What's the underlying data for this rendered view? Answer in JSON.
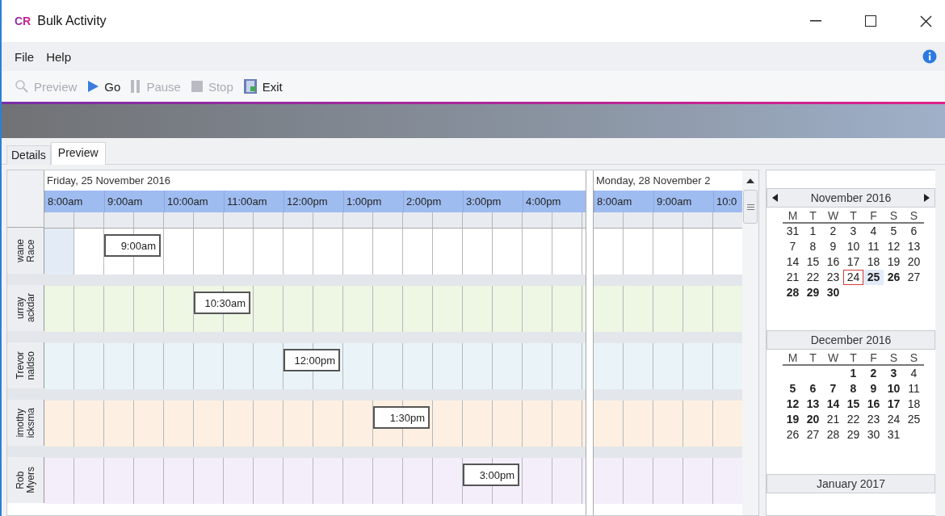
{
  "window": {
    "logo": "CR",
    "title": "Bulk Activity"
  },
  "menu": [
    {
      "label": "File"
    },
    {
      "label": "Help"
    }
  ],
  "toolbar": [
    {
      "label": "Preview",
      "kind": "search",
      "disabled": true
    },
    {
      "label": "Go",
      "kind": "play",
      "disabled": false
    },
    {
      "label": "Pause",
      "kind": "pause",
      "disabled": true
    },
    {
      "label": "Stop",
      "kind": "stop",
      "disabled": true
    },
    {
      "label": "Exit",
      "kind": "exit",
      "disabled": false
    }
  ],
  "tabs": [
    {
      "label": "Details",
      "selected": false
    },
    {
      "label": "Preview",
      "selected": true
    }
  ],
  "schedule": {
    "days": [
      {
        "title": "Friday, 25 November 2016",
        "hours": [
          "8:00am",
          "9:00am",
          "10:00am",
          "11:00am",
          "12:00pm",
          "1:00pm",
          "2:00pm",
          "3:00pm",
          "4:00pm"
        ]
      },
      {
        "title": "Monday, 28 November 2",
        "hours": [
          "8:00am",
          "9:00am",
          "10:0"
        ]
      }
    ],
    "resources": [
      {
        "name": [
          "wane",
          "Race"
        ],
        "color": "#ffffff",
        "cells": [
          {
            "kind": "highlight"
          },
          {
            "kind": "free"
          },
          {
            "kind": "booked",
            "time": "9:00am"
          },
          {
            "kind": "free"
          },
          {
            "kind": "free"
          },
          {
            "kind": "free"
          },
          {
            "kind": "free"
          },
          {
            "kind": "free"
          },
          {
            "kind": "free"
          },
          {
            "kind": "free"
          },
          {
            "kind": "free"
          },
          {
            "kind": "free"
          },
          {
            "kind": "free"
          },
          {
            "kind": "free"
          },
          {
            "kind": "free"
          },
          {
            "kind": "free"
          },
          {
            "kind": "free"
          },
          {
            "kind": "free"
          }
        ]
      },
      {
        "name": [
          "urray",
          "ackdar"
        ],
        "color": "#eef6e4",
        "cells": [
          {
            "kind": "free"
          },
          {
            "kind": "free"
          },
          {
            "kind": "free"
          },
          {
            "kind": "free"
          },
          {
            "kind": "free"
          },
          {
            "kind": "booked",
            "time": "10:30am"
          },
          {
            "kind": "free"
          },
          {
            "kind": "free"
          },
          {
            "kind": "free"
          },
          {
            "kind": "free"
          },
          {
            "kind": "free"
          },
          {
            "kind": "free"
          },
          {
            "kind": "free"
          },
          {
            "kind": "free"
          },
          {
            "kind": "free"
          },
          {
            "kind": "free"
          },
          {
            "kind": "free"
          },
          {
            "kind": "free"
          }
        ]
      },
      {
        "name": [
          "Trevor",
          "naldso"
        ],
        "color": "#eaf4f8",
        "cells": [
          {
            "kind": "free"
          },
          {
            "kind": "free"
          },
          {
            "kind": "free"
          },
          {
            "kind": "free"
          },
          {
            "kind": "free"
          },
          {
            "kind": "free"
          },
          {
            "kind": "free"
          },
          {
            "kind": "free"
          },
          {
            "kind": "booked",
            "time": "12:00pm"
          },
          {
            "kind": "free"
          },
          {
            "kind": "free"
          },
          {
            "kind": "free"
          },
          {
            "kind": "free"
          },
          {
            "kind": "free"
          },
          {
            "kind": "free"
          },
          {
            "kind": "free"
          },
          {
            "kind": "free"
          },
          {
            "kind": "free"
          }
        ]
      },
      {
        "name": [
          "imothy",
          "icksma"
        ],
        "color": "#fdf0e2",
        "cells": [
          {
            "kind": "free"
          },
          {
            "kind": "free"
          },
          {
            "kind": "free"
          },
          {
            "kind": "free"
          },
          {
            "kind": "free"
          },
          {
            "kind": "free"
          },
          {
            "kind": "free"
          },
          {
            "kind": "free"
          },
          {
            "kind": "free"
          },
          {
            "kind": "free"
          },
          {
            "kind": "free"
          },
          {
            "kind": "booked",
            "time": "1:30pm"
          },
          {
            "kind": "free"
          },
          {
            "kind": "free"
          },
          {
            "kind": "free"
          },
          {
            "kind": "free"
          },
          {
            "kind": "free"
          },
          {
            "kind": "free"
          }
        ]
      },
      {
        "name": [
          "Rob",
          "Myers"
        ],
        "color": "#f4eefb",
        "cells": [
          {
            "kind": "free"
          },
          {
            "kind": "free"
          },
          {
            "kind": "free"
          },
          {
            "kind": "free"
          },
          {
            "kind": "free"
          },
          {
            "kind": "free"
          },
          {
            "kind": "free"
          },
          {
            "kind": "free"
          },
          {
            "kind": "free"
          },
          {
            "kind": "free"
          },
          {
            "kind": "free"
          },
          {
            "kind": "free"
          },
          {
            "kind": "free"
          },
          {
            "kind": "free"
          },
          {
            "kind": "booked",
            "time": "3:00pm"
          },
          {
            "kind": "free"
          },
          {
            "kind": "free"
          },
          {
            "kind": "free"
          }
        ]
      }
    ]
  },
  "calendar": {
    "months": [
      {
        "title": "November 2016",
        "arrows": true,
        "weekdays": [
          "M",
          "T",
          "W",
          "T",
          "F",
          "S",
          "S"
        ],
        "weeks": [
          {
            "days": [
              {
                "d": "31",
                "bold": false,
                "today": false,
                "selected": false
              },
              {
                "d": "1",
                "bold": false,
                "today": false,
                "selected": false
              },
              {
                "d": "2",
                "bold": false,
                "today": false,
                "selected": false
              },
              {
                "d": "3",
                "bold": false,
                "today": false,
                "selected": false
              },
              {
                "d": "4",
                "bold": false,
                "today": false,
                "selected": false
              },
              {
                "d": "5",
                "bold": false,
                "today": false,
                "selected": false
              },
              {
                "d": "6",
                "bold": false,
                "today": false,
                "selected": false
              }
            ]
          },
          {
            "days": [
              {
                "d": "7",
                "bold": false,
                "today": false,
                "selected": false
              },
              {
                "d": "8",
                "bold": false,
                "today": false,
                "selected": false
              },
              {
                "d": "9",
                "bold": false,
                "today": false,
                "selected": false
              },
              {
                "d": "10",
                "bold": false,
                "today": false,
                "selected": false
              },
              {
                "d": "11",
                "bold": false,
                "today": false,
                "selected": false
              },
              {
                "d": "12",
                "bold": false,
                "today": false,
                "selected": false
              },
              {
                "d": "13",
                "bold": false,
                "today": false,
                "selected": false
              }
            ]
          },
          {
            "days": [
              {
                "d": "14",
                "bold": false,
                "today": false,
                "selected": false
              },
              {
                "d": "15",
                "bold": false,
                "today": false,
                "selected": false
              },
              {
                "d": "16",
                "bold": false,
                "today": false,
                "selected": false
              },
              {
                "d": "17",
                "bold": false,
                "today": false,
                "selected": false
              },
              {
                "d": "18",
                "bold": false,
                "today": false,
                "selected": false
              },
              {
                "d": "19",
                "bold": false,
                "today": false,
                "selected": false
              },
              {
                "d": "20",
                "bold": false,
                "today": false,
                "selected": false
              }
            ]
          },
          {
            "days": [
              {
                "d": "21",
                "bold": false,
                "today": false,
                "selected": false
              },
              {
                "d": "22",
                "bold": false,
                "today": false,
                "selected": false
              },
              {
                "d": "23",
                "bold": false,
                "today": false,
                "selected": false
              },
              {
                "d": "24",
                "bold": false,
                "today": true,
                "selected": false
              },
              {
                "d": "25",
                "bold": true,
                "today": false,
                "selected": true
              },
              {
                "d": "26",
                "bold": true,
                "today": false,
                "selected": false
              },
              {
                "d": "27",
                "bold": false,
                "today": false,
                "selected": false
              }
            ]
          },
          {
            "days": [
              {
                "d": "28",
                "bold": true,
                "today": false,
                "selected": false
              },
              {
                "d": "29",
                "bold": true,
                "today": false,
                "selected": false
              },
              {
                "d": "30",
                "bold": true,
                "today": false,
                "selected": false
              }
            ]
          }
        ]
      },
      {
        "title": "December 2016",
        "arrows": false,
        "weekdays": [
          "M",
          "T",
          "W",
          "T",
          "F",
          "S",
          "S"
        ],
        "weeks": [
          {
            "days": [
              {
                "d": "1",
                "bold": true,
                "today": false,
                "selected": false
              },
              {
                "d": "2",
                "bold": true,
                "today": false,
                "selected": false
              },
              {
                "d": "3",
                "bold": true,
                "today": false,
                "selected": false
              },
              {
                "d": "4",
                "bold": false,
                "today": false,
                "selected": false
              }
            ]
          },
          {
            "days": [
              {
                "d": "5",
                "bold": true,
                "today": false,
                "selected": false
              },
              {
                "d": "6",
                "bold": true,
                "today": false,
                "selected": false
              },
              {
                "d": "7",
                "bold": true,
                "today": false,
                "selected": false
              },
              {
                "d": "8",
                "bold": true,
                "today": false,
                "selected": false
              },
              {
                "d": "9",
                "bold": true,
                "today": false,
                "selected": false
              },
              {
                "d": "10",
                "bold": true,
                "today": false,
                "selected": false
              },
              {
                "d": "11",
                "bold": false,
                "today": false,
                "selected": false
              }
            ]
          },
          {
            "days": [
              {
                "d": "12",
                "bold": true,
                "today": false,
                "selected": false
              },
              {
                "d": "13",
                "bold": true,
                "today": false,
                "selected": false
              },
              {
                "d": "14",
                "bold": true,
                "today": false,
                "selected": false
              },
              {
                "d": "15",
                "bold": true,
                "today": false,
                "selected": false
              },
              {
                "d": "16",
                "bold": true,
                "today": false,
                "selected": false
              },
              {
                "d": "17",
                "bold": true,
                "today": false,
                "selected": false
              },
              {
                "d": "18",
                "bold": false,
                "today": false,
                "selected": false
              }
            ]
          },
          {
            "days": [
              {
                "d": "19",
                "bold": true,
                "today": false,
                "selected": false
              },
              {
                "d": "20",
                "bold": true,
                "today": false,
                "selected": false
              },
              {
                "d": "21",
                "bold": false,
                "today": false,
                "selected": false
              },
              {
                "d": "22",
                "bold": false,
                "today": false,
                "selected": false
              },
              {
                "d": "23",
                "bold": false,
                "today": false,
                "selected": false
              },
              {
                "d": "24",
                "bold": false,
                "today": false,
                "selected": false
              },
              {
                "d": "25",
                "bold": false,
                "today": false,
                "selected": false
              }
            ]
          },
          {
            "days": [
              {
                "d": "26",
                "bold": false,
                "today": false,
                "selected": false
              },
              {
                "d": "27",
                "bold": false,
                "today": false,
                "selected": false
              },
              {
                "d": "28",
                "bold": false,
                "today": false,
                "selected": false
              },
              {
                "d": "29",
                "bold": false,
                "today": false,
                "selected": false
              },
              {
                "d": "30",
                "bold": false,
                "today": false,
                "selected": false
              },
              {
                "d": "31",
                "bold": false,
                "today": false,
                "selected": false
              }
            ]
          }
        ]
      },
      {
        "title": "January 2017",
        "arrows": false
      }
    ]
  }
}
